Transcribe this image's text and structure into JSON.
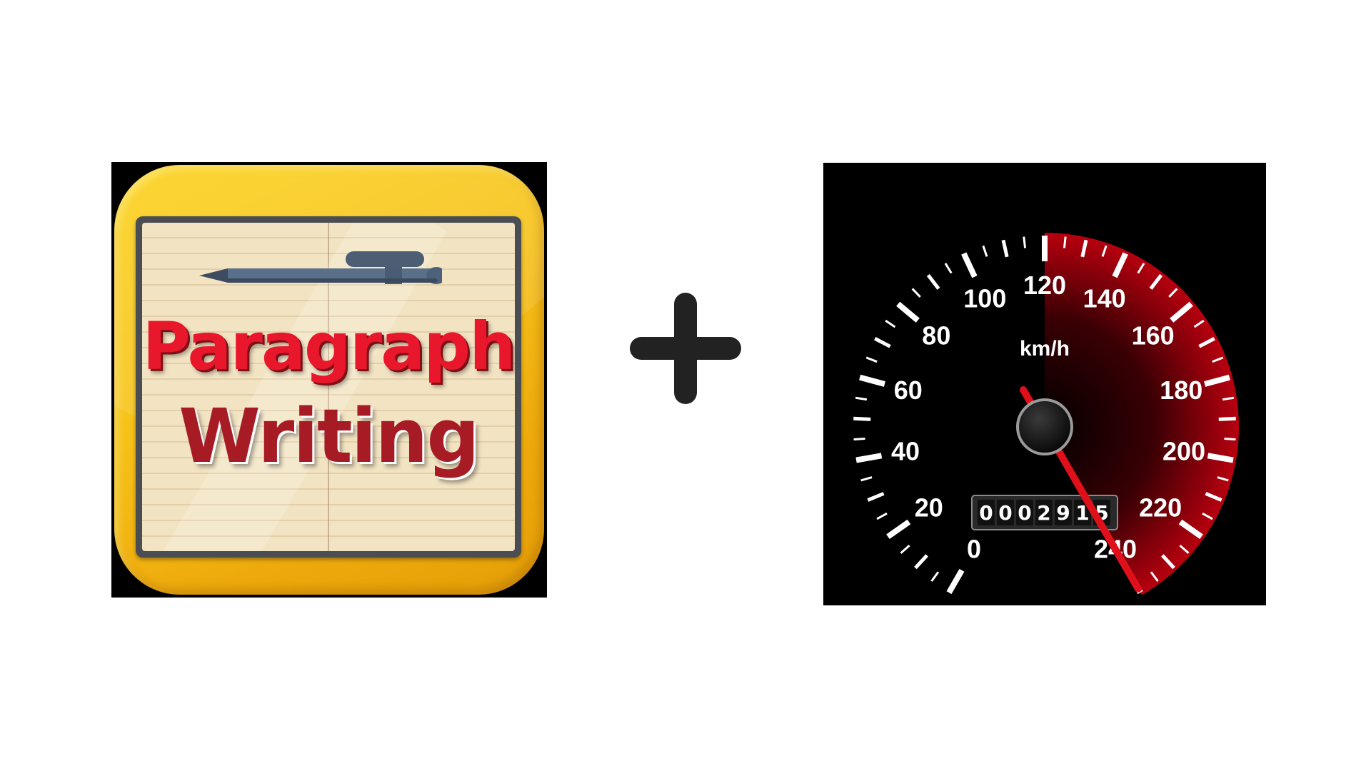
{
  "app_icon": {
    "title_line_1": "Paragraph",
    "title_line_2": "Writing",
    "icon": "pen-icon",
    "colors": {
      "background": "#f7c41a",
      "line_1": "#e8172b",
      "line_2": "#a71b24",
      "paper": "#f2e3c2"
    }
  },
  "plus_sign": {
    "icon": "plus-icon",
    "color": "#222222"
  },
  "speedometer": {
    "unit": "km/h",
    "scale_labels": [
      "0",
      "20",
      "40",
      "60",
      "80",
      "100",
      "120",
      "140",
      "160",
      "180",
      "200",
      "220",
      "240"
    ],
    "scale_min": 0,
    "scale_max": 240,
    "needle_value": 240,
    "odometer_digits": [
      "0",
      "0",
      "0",
      "2",
      "9",
      "1",
      "5"
    ],
    "colors": {
      "face": "#000000",
      "needle": "#e0101a",
      "redline_zone": "#b00010",
      "ticks": "#ffffff"
    }
  }
}
